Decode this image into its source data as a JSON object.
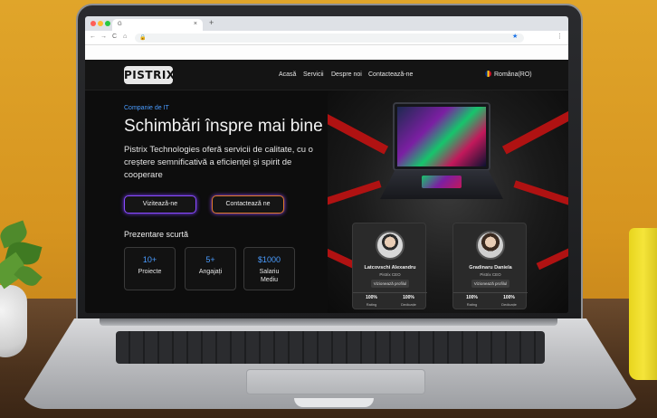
{
  "browser": {
    "tab_icon": "G",
    "tab_close": "×",
    "new_tab": "+",
    "back": "←",
    "forward": "→",
    "reload": "C",
    "home": "⌂",
    "lock": "🔒",
    "bookmark": "★",
    "menu": "⋮"
  },
  "site": {
    "logo": "PISTRIX",
    "nav": {
      "home": "Acasă",
      "services": "Servicii",
      "about": "Despre noi",
      "contact": "Contactează-ne"
    },
    "language": "Româna(RO)",
    "kicker": "Companie de IT",
    "headline": "Schimbări înspre mai bine",
    "description": "Pistrix Technologies oferă servicii de calitate, cu o creștere semnificativă a eficienței și spirit de cooperare",
    "buttons": {
      "visit": "Vizitează-ne",
      "contact": "Contactează ne"
    },
    "subheading": "Prezentare scurtă",
    "stats": [
      {
        "value": "10+",
        "label": "Proiecte"
      },
      {
        "value": "5+",
        "label": "Angajați"
      },
      {
        "value": "$1000",
        "label": "Salariu Mediu"
      }
    ],
    "team": [
      {
        "name": "Latcovschi Alexandru",
        "role": "Pistrix CEO",
        "profile_btn": "Vizionează profilul",
        "m1_value": "100%",
        "m1_label": "Rating",
        "m2_value": "100%",
        "m2_label": "Dedicație"
      },
      {
        "name": "Gradinaru Daniela",
        "role": "Pistrix CEO",
        "profile_btn": "Vizionează profilul",
        "m1_value": "100%",
        "m1_label": "Rating",
        "m2_value": "100%",
        "m2_label": "Dedicație"
      }
    ]
  },
  "colors": {
    "accent_blue": "#4a9cff",
    "button_purple": "#8a4bff",
    "button_orange": "#e07a2a",
    "hero_red": "#b01212"
  }
}
